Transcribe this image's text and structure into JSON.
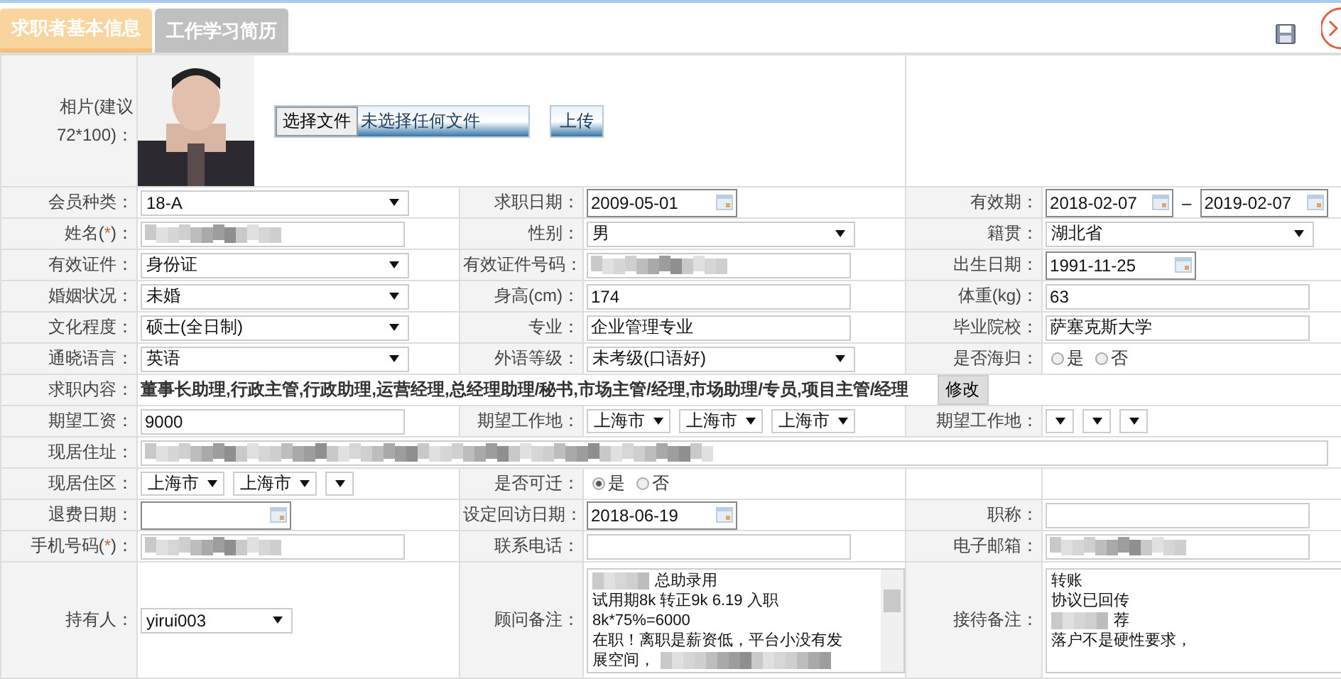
{
  "tabs": [
    {
      "label": "求职者基本信息",
      "selected": true
    },
    {
      "label": "工作学习简历",
      "selected": false
    }
  ],
  "photo_row": {
    "label": "相片(建议72*100)：",
    "file_button": "选择文件",
    "file_status": "未选择任何文件",
    "upload_button": "上传"
  },
  "rows": [
    {
      "cells": [
        {
          "kind": "label",
          "text": "会员种类："
        },
        {
          "kind": "select",
          "value": "18-A"
        },
        {
          "kind": "label",
          "text": "求职日期："
        },
        {
          "kind": "date",
          "value": "2009-05-01"
        },
        {
          "kind": "label",
          "text": "有效期："
        },
        {
          "kind": "date-range",
          "from": "2018-02-07",
          "sep": "–",
          "to": "2019-02-07"
        }
      ]
    },
    {
      "cells": [
        {
          "kind": "label",
          "text": "姓名(",
          "mark": "*",
          "tail": ")："
        },
        {
          "kind": "masked-input"
        },
        {
          "kind": "label",
          "text": "性别："
        },
        {
          "kind": "select",
          "value": "男"
        },
        {
          "kind": "label",
          "text": "籍贯："
        },
        {
          "kind": "select",
          "value": "湖北省"
        }
      ]
    },
    {
      "cells": [
        {
          "kind": "label",
          "text": "有效证件："
        },
        {
          "kind": "select",
          "value": "身份证"
        },
        {
          "kind": "label",
          "text": "有效证件号码："
        },
        {
          "kind": "masked-input"
        },
        {
          "kind": "label",
          "text": "出生日期："
        },
        {
          "kind": "date",
          "value": "1991-11-25"
        }
      ]
    },
    {
      "cells": [
        {
          "kind": "label",
          "text": "婚姻状况："
        },
        {
          "kind": "select",
          "value": "未婚"
        },
        {
          "kind": "label",
          "text": "身高(cm)："
        },
        {
          "kind": "text",
          "value": "174"
        },
        {
          "kind": "label",
          "text": "体重(kg)："
        },
        {
          "kind": "text",
          "value": "63"
        }
      ]
    },
    {
      "cells": [
        {
          "kind": "label",
          "text": "文化程度："
        },
        {
          "kind": "select",
          "value": "硕士(全日制)"
        },
        {
          "kind": "label",
          "text": "专业："
        },
        {
          "kind": "text",
          "value": "企业管理专业"
        },
        {
          "kind": "label",
          "text": "毕业院校："
        },
        {
          "kind": "text",
          "value": "萨塞克斯大学"
        }
      ]
    },
    {
      "cells": [
        {
          "kind": "label",
          "text": "通晓语言："
        },
        {
          "kind": "select",
          "value": "英语"
        },
        {
          "kind": "label",
          "text": "外语等级："
        },
        {
          "kind": "select",
          "value": "未考级(口语好)"
        },
        {
          "kind": "label",
          "text": "是否海归："
        },
        {
          "kind": "radios",
          "options": [
            {
              "label": "是",
              "selected": false
            },
            {
              "label": "否",
              "selected": false
            }
          ]
        }
      ]
    },
    {
      "cells": [
        {
          "kind": "label",
          "text": "求职内容："
        },
        {
          "kind": "tags",
          "wide": true,
          "text": "董事长助理,行政主管,行政助理,运营经理,总经理助理/秘书,市场主管/经理,市场助理/专员,项目主管/经理",
          "button": "修改"
        }
      ]
    },
    {
      "cells": [
        {
          "kind": "label",
          "text": "期望工资："
        },
        {
          "kind": "text",
          "value": "9000"
        },
        {
          "kind": "label",
          "text": "期望工作地："
        },
        {
          "kind": "selects",
          "items": [
            {
              "value": "上海市",
              "empty": false
            },
            {
              "value": "上海市",
              "empty": false
            },
            {
              "value": "上海市",
              "empty": false
            }
          ]
        },
        {
          "kind": "label",
          "text": "期望工作地："
        },
        {
          "kind": "selects",
          "items": [
            {
              "empty": true
            },
            {
              "empty": true
            },
            {
              "empty": true
            }
          ]
        }
      ]
    },
    {
      "cells": [
        {
          "kind": "label",
          "text": "现居住址："
        },
        {
          "kind": "masked-input",
          "wide": true
        }
      ]
    },
    {
      "cells": [
        {
          "kind": "label",
          "text": "现居住区："
        },
        {
          "kind": "selects",
          "items": [
            {
              "value": "上海市",
              "empty": false
            },
            {
              "value": "上海市",
              "empty": false
            },
            {
              "empty": true
            }
          ]
        },
        {
          "kind": "label",
          "text": "是否可迁："
        },
        {
          "kind": "radios",
          "options": [
            {
              "label": "是",
              "selected": true
            },
            {
              "label": "否",
              "selected": false
            }
          ]
        },
        {
          "kind": "blank"
        },
        {
          "kind": "blank"
        }
      ]
    },
    {
      "cells": [
        {
          "kind": "label",
          "text": "退费日期："
        },
        {
          "kind": "date"
        },
        {
          "kind": "label",
          "text": "设定回访日期："
        },
        {
          "kind": "date",
          "value": "2018-06-19"
        },
        {
          "kind": "label",
          "text": "职称："
        },
        {
          "kind": "text"
        }
      ]
    },
    {
      "cells": [
        {
          "kind": "label",
          "text": "手机号码(",
          "mark": "*",
          "tail": ")："
        },
        {
          "kind": "masked-input"
        },
        {
          "kind": "label",
          "text": "联系电话："
        },
        {
          "kind": "text"
        },
        {
          "kind": "label",
          "text": "电子邮箱："
        },
        {
          "kind": "masked-input"
        }
      ]
    },
    {
      "cells": [
        {
          "kind": "label",
          "text": "持有人："
        },
        {
          "kind": "select",
          "value": "yirui003"
        },
        {
          "kind": "label",
          "text": "顾问备注："
        },
        {
          "kind": "notes",
          "scroll": true,
          "lines": [
            {
              "parts": [
                {
                  "kind": "masked"
                },
                {
                  "kind": "text",
                  "text": "总助录用"
                }
              ]
            },
            {
              "parts": [
                {
                  "kind": "text",
                  "text": "试用期8k 转正9k 6.19 入职"
                }
              ]
            },
            {
              "parts": [
                {
                  "kind": "text",
                  "text": "8k*75%=6000"
                }
              ]
            },
            {
              "parts": [
                {
                  "kind": "text",
                  "text": "在职！离职是薪资低，平台小没有发"
                }
              ]
            },
            {
              "parts": [
                {
                  "kind": "text",
                  "text": "展空间，"
                },
                {
                  "kind": "masked"
                }
              ]
            }
          ]
        },
        {
          "kind": "label",
          "text": "接待备注："
        },
        {
          "kind": "notes",
          "scroll": false,
          "lines": [
            {
              "parts": [
                {
                  "kind": "text",
                  "text": "转账"
                }
              ]
            },
            {
              "parts": [
                {
                  "kind": "text",
                  "text": "协议已回传"
                }
              ]
            },
            {
              "parts": [
                {
                  "kind": "masked"
                },
                {
                  "kind": "text",
                  "text": "荐"
                }
              ]
            },
            {
              "parts": [
                {
                  "kind": "text",
                  "text": "落户不是硬性要求，"
                }
              ]
            }
          ]
        }
      ]
    }
  ]
}
